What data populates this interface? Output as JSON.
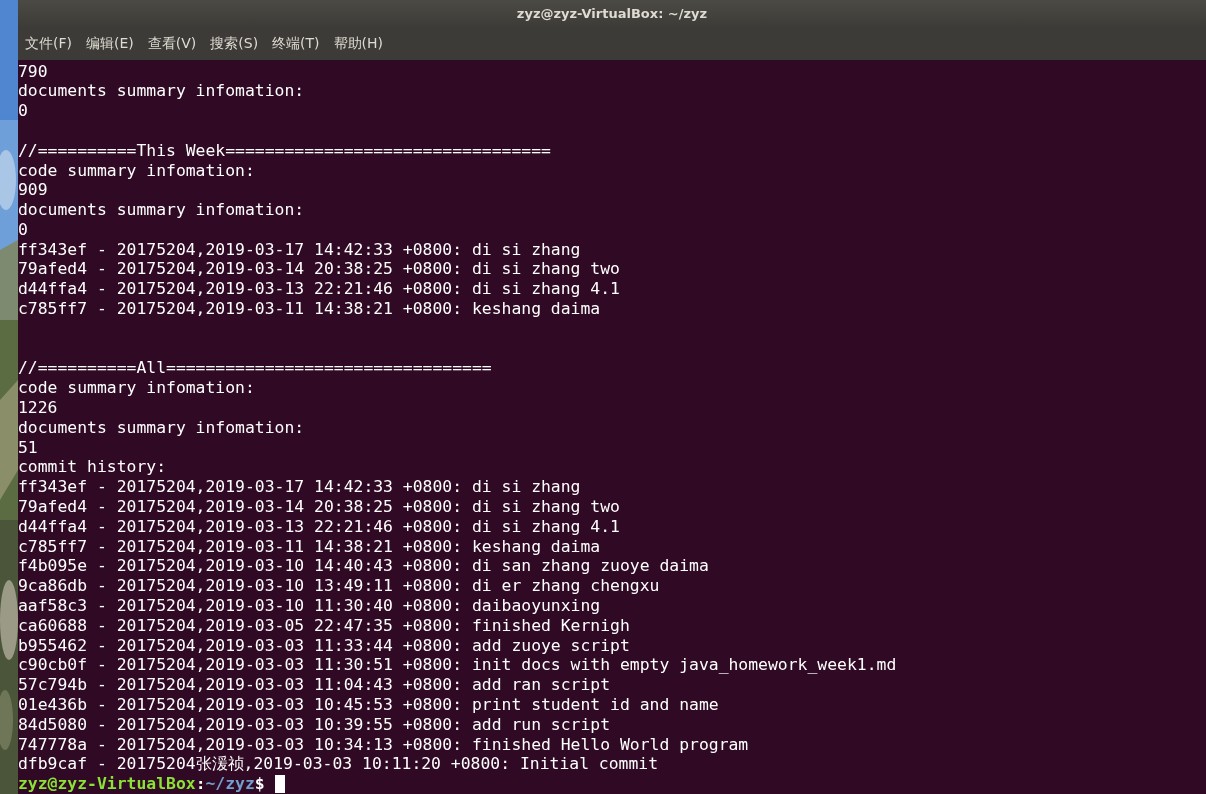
{
  "window": {
    "title": "zyz@zyz-VirtualBox: ~/zyz"
  },
  "menu": [
    "文件(F)",
    "编辑(E)",
    "查看(V)",
    "搜索(S)",
    "终端(T)",
    "帮助(H)"
  ],
  "lines": [
    {
      "kind": "text",
      "text": "790"
    },
    {
      "kind": "text",
      "text": "documents summary infomation:"
    },
    {
      "kind": "text",
      "text": "0"
    },
    {
      "kind": "blank"
    },
    {
      "kind": "text",
      "text": "//==========This Week================================="
    },
    {
      "kind": "text",
      "text": "code summary infomation:"
    },
    {
      "kind": "text",
      "text": "909"
    },
    {
      "kind": "text",
      "text": "documents summary infomation:"
    },
    {
      "kind": "text",
      "text": "0"
    },
    {
      "kind": "text",
      "text": "ff343ef - 20175204,2019-03-17 14:42:33 +0800: di si zhang"
    },
    {
      "kind": "text",
      "text": "79afed4 - 20175204,2019-03-14 20:38:25 +0800: di si zhang two"
    },
    {
      "kind": "text",
      "text": "d44ffa4 - 20175204,2019-03-13 22:21:46 +0800: di si zhang 4.1"
    },
    {
      "kind": "text",
      "text": "c785ff7 - 20175204,2019-03-11 14:38:21 +0800: keshang daima"
    },
    {
      "kind": "blank"
    },
    {
      "kind": "blank"
    },
    {
      "kind": "text",
      "text": "//==========All================================="
    },
    {
      "kind": "text",
      "text": "code summary infomation:"
    },
    {
      "kind": "text",
      "text": "1226"
    },
    {
      "kind": "text",
      "text": "documents summary infomation:"
    },
    {
      "kind": "text",
      "text": "51"
    },
    {
      "kind": "text",
      "text": "commit history:"
    },
    {
      "kind": "text",
      "text": "ff343ef - 20175204,2019-03-17 14:42:33 +0800: di si zhang"
    },
    {
      "kind": "text",
      "text": "79afed4 - 20175204,2019-03-14 20:38:25 +0800: di si zhang two"
    },
    {
      "kind": "text",
      "text": "d44ffa4 - 20175204,2019-03-13 22:21:46 +0800: di si zhang 4.1"
    },
    {
      "kind": "text",
      "text": "c785ff7 - 20175204,2019-03-11 14:38:21 +0800: keshang daima"
    },
    {
      "kind": "text",
      "text": "f4b095e - 20175204,2019-03-10 14:40:43 +0800: di san zhang zuoye daima"
    },
    {
      "kind": "text",
      "text": "9ca86db - 20175204,2019-03-10 13:49:11 +0800: di er zhang chengxu"
    },
    {
      "kind": "text",
      "text": "aaf58c3 - 20175204,2019-03-10 11:30:40 +0800: daibaoyunxing"
    },
    {
      "kind": "text",
      "text": "ca60688 - 20175204,2019-03-05 22:47:35 +0800: finished Kernigh"
    },
    {
      "kind": "text",
      "text": "b955462 - 20175204,2019-03-03 11:33:44 +0800: add zuoye script"
    },
    {
      "kind": "text",
      "text": "c90cb0f - 20175204,2019-03-03 11:30:51 +0800: init docs with empty java_homework_week1.md"
    },
    {
      "kind": "text",
      "text": "57c794b - 20175204,2019-03-03 11:04:43 +0800: add ran script"
    },
    {
      "kind": "text",
      "text": "01e436b - 20175204,2019-03-03 10:45:53 +0800: print student id and name"
    },
    {
      "kind": "text",
      "text": "84d5080 - 20175204,2019-03-03 10:39:55 +0800: add run script"
    },
    {
      "kind": "text",
      "text": "747778a - 20175204,2019-03-03 10:34:13 +0800: finished Hello World program"
    },
    {
      "kind": "text",
      "text": "dfb9caf - 20175204张湲祯,2019-03-03 10:11:20 +0800: Initial commit"
    }
  ],
  "prompt": {
    "user_host": "zyz@zyz-VirtualBox",
    "separator": ":",
    "path": "~/zyz",
    "symbol": "$"
  }
}
